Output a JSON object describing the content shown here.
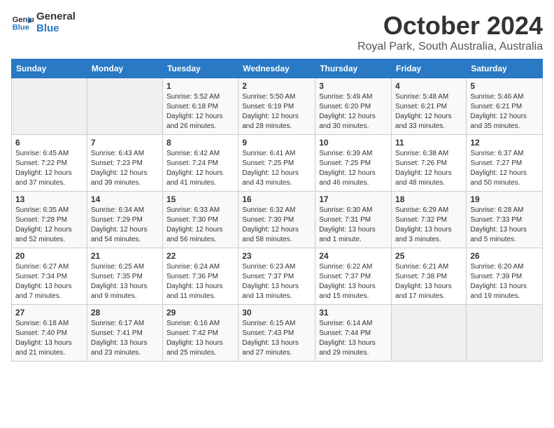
{
  "logo": {
    "line1": "General",
    "line2": "Blue"
  },
  "title": "October 2024",
  "subtitle": "Royal Park, South Australia, Australia",
  "headers": [
    "Sunday",
    "Monday",
    "Tuesday",
    "Wednesday",
    "Thursday",
    "Friday",
    "Saturday"
  ],
  "weeks": [
    [
      {
        "day": "",
        "info": ""
      },
      {
        "day": "",
        "info": ""
      },
      {
        "day": "1",
        "info": "Sunrise: 5:52 AM\nSunset: 6:18 PM\nDaylight: 12 hours\nand 26 minutes."
      },
      {
        "day": "2",
        "info": "Sunrise: 5:50 AM\nSunset: 6:19 PM\nDaylight: 12 hours\nand 28 minutes."
      },
      {
        "day": "3",
        "info": "Sunrise: 5:49 AM\nSunset: 6:20 PM\nDaylight: 12 hours\nand 30 minutes."
      },
      {
        "day": "4",
        "info": "Sunrise: 5:48 AM\nSunset: 6:21 PM\nDaylight: 12 hours\nand 33 minutes."
      },
      {
        "day": "5",
        "info": "Sunrise: 5:46 AM\nSunset: 6:21 PM\nDaylight: 12 hours\nand 35 minutes."
      }
    ],
    [
      {
        "day": "6",
        "info": "Sunrise: 6:45 AM\nSunset: 7:22 PM\nDaylight: 12 hours\nand 37 minutes."
      },
      {
        "day": "7",
        "info": "Sunrise: 6:43 AM\nSunset: 7:23 PM\nDaylight: 12 hours\nand 39 minutes."
      },
      {
        "day": "8",
        "info": "Sunrise: 6:42 AM\nSunset: 7:24 PM\nDaylight: 12 hours\nand 41 minutes."
      },
      {
        "day": "9",
        "info": "Sunrise: 6:41 AM\nSunset: 7:25 PM\nDaylight: 12 hours\nand 43 minutes."
      },
      {
        "day": "10",
        "info": "Sunrise: 6:39 AM\nSunset: 7:25 PM\nDaylight: 12 hours\nand 46 minutes."
      },
      {
        "day": "11",
        "info": "Sunrise: 6:38 AM\nSunset: 7:26 PM\nDaylight: 12 hours\nand 48 minutes."
      },
      {
        "day": "12",
        "info": "Sunrise: 6:37 AM\nSunset: 7:27 PM\nDaylight: 12 hours\nand 50 minutes."
      }
    ],
    [
      {
        "day": "13",
        "info": "Sunrise: 6:35 AM\nSunset: 7:28 PM\nDaylight: 12 hours\nand 52 minutes."
      },
      {
        "day": "14",
        "info": "Sunrise: 6:34 AM\nSunset: 7:29 PM\nDaylight: 12 hours\nand 54 minutes."
      },
      {
        "day": "15",
        "info": "Sunrise: 6:33 AM\nSunset: 7:30 PM\nDaylight: 12 hours\nand 56 minutes."
      },
      {
        "day": "16",
        "info": "Sunrise: 6:32 AM\nSunset: 7:30 PM\nDaylight: 12 hours\nand 58 minutes."
      },
      {
        "day": "17",
        "info": "Sunrise: 6:30 AM\nSunset: 7:31 PM\nDaylight: 13 hours\nand 1 minute."
      },
      {
        "day": "18",
        "info": "Sunrise: 6:29 AM\nSunset: 7:32 PM\nDaylight: 13 hours\nand 3 minutes."
      },
      {
        "day": "19",
        "info": "Sunrise: 6:28 AM\nSunset: 7:33 PM\nDaylight: 13 hours\nand 5 minutes."
      }
    ],
    [
      {
        "day": "20",
        "info": "Sunrise: 6:27 AM\nSunset: 7:34 PM\nDaylight: 13 hours\nand 7 minutes."
      },
      {
        "day": "21",
        "info": "Sunrise: 6:25 AM\nSunset: 7:35 PM\nDaylight: 13 hours\nand 9 minutes."
      },
      {
        "day": "22",
        "info": "Sunrise: 6:24 AM\nSunset: 7:36 PM\nDaylight: 13 hours\nand 11 minutes."
      },
      {
        "day": "23",
        "info": "Sunrise: 6:23 AM\nSunset: 7:37 PM\nDaylight: 13 hours\nand 13 minutes."
      },
      {
        "day": "24",
        "info": "Sunrise: 6:22 AM\nSunset: 7:37 PM\nDaylight: 13 hours\nand 15 minutes."
      },
      {
        "day": "25",
        "info": "Sunrise: 6:21 AM\nSunset: 7:38 PM\nDaylight: 13 hours\nand 17 minutes."
      },
      {
        "day": "26",
        "info": "Sunrise: 6:20 AM\nSunset: 7:39 PM\nDaylight: 13 hours\nand 19 minutes."
      }
    ],
    [
      {
        "day": "27",
        "info": "Sunrise: 6:18 AM\nSunset: 7:40 PM\nDaylight: 13 hours\nand 21 minutes."
      },
      {
        "day": "28",
        "info": "Sunrise: 6:17 AM\nSunset: 7:41 PM\nDaylight: 13 hours\nand 23 minutes."
      },
      {
        "day": "29",
        "info": "Sunrise: 6:16 AM\nSunset: 7:42 PM\nDaylight: 13 hours\nand 25 minutes."
      },
      {
        "day": "30",
        "info": "Sunrise: 6:15 AM\nSunset: 7:43 PM\nDaylight: 13 hours\nand 27 minutes."
      },
      {
        "day": "31",
        "info": "Sunrise: 6:14 AM\nSunset: 7:44 PM\nDaylight: 13 hours\nand 29 minutes."
      },
      {
        "day": "",
        "info": ""
      },
      {
        "day": "",
        "info": ""
      }
    ]
  ]
}
